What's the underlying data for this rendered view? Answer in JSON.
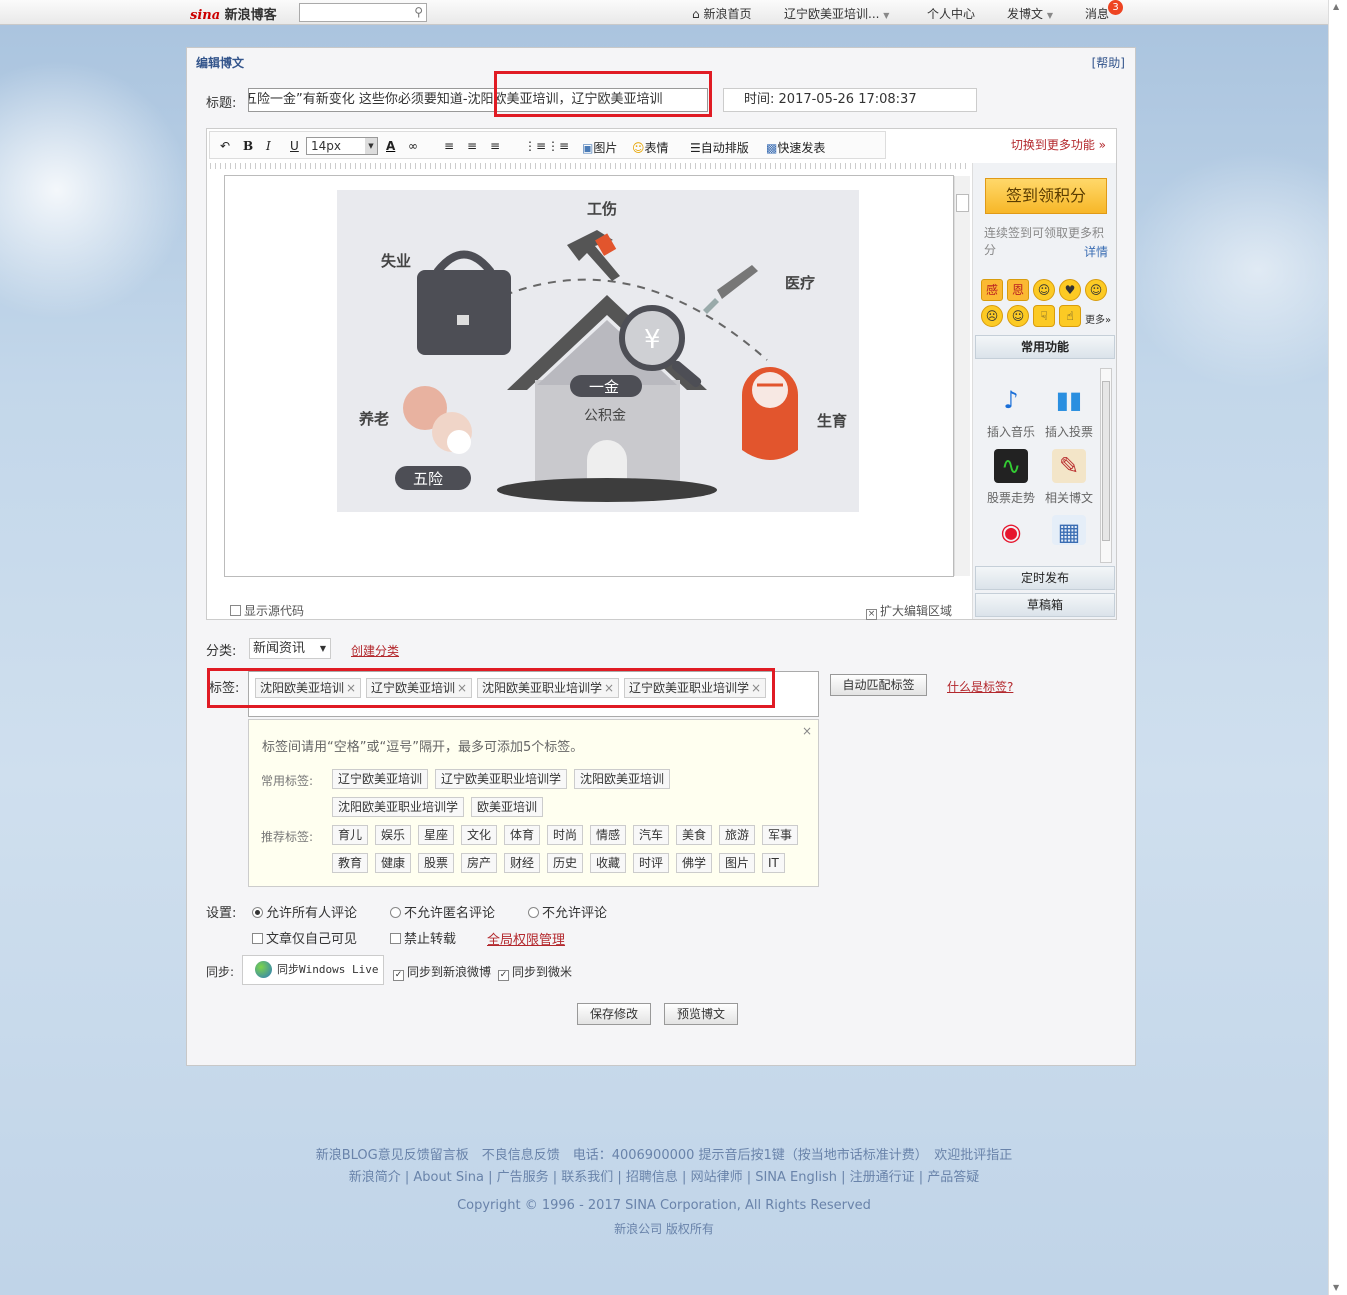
{
  "topbar": {
    "logo_sina": "sina",
    "logo_text": "新浪博客",
    "nav": [
      "新浪首页",
      "辽宁欧美亚培训...",
      "个人中心",
      "发博文",
      "消息"
    ],
    "badge": "3"
  },
  "panel": {
    "title": "编辑博文",
    "help": "[帮助]",
    "title_label": "标题:",
    "title_value": "五险一金”有新变化 这些你必须要知道-沈阳欧美亚培训，辽宁欧美亚培训",
    "time_label": "时间:",
    "time_value": "2017-05-26 17:08:37"
  },
  "toolbar": {
    "font_size": "14px",
    "image": "图片",
    "emotion": "表情",
    "autolayout": "自动排版",
    "quickpost": "快速发表",
    "more": "切换到更多功能"
  },
  "illustration": {
    "labels": [
      "工伤",
      "失业",
      "医疗",
      "养老",
      "生育",
      "一金",
      "公积金",
      "五险"
    ],
    "currency": "¥"
  },
  "editor": {
    "show_source": "显示源代码",
    "expand": "扩大编辑区域"
  },
  "side": {
    "sign_button": "签到领积分",
    "sign_text": "连续签到可领取更多积分",
    "detail": "详情",
    "emotions_more": "更多»",
    "emo_text": [
      "感",
      "恩"
    ],
    "common_header": "常用功能",
    "funcs": [
      "插入音乐",
      "插入投票",
      "股票走势",
      "相关博文"
    ],
    "schedule": "定时发布",
    "drafts": "草稿箱"
  },
  "category": {
    "label": "分类:",
    "value": "新闻资讯",
    "create": "创建分类"
  },
  "tags": {
    "label": "标签:",
    "items": [
      "沈阳欧美亚培训",
      "辽宁欧美亚培训",
      "沈阳欧美亚职业培训学",
      "辽宁欧美亚职业培训学"
    ],
    "auto_button": "自动匹配标签",
    "what": "什么是标签?",
    "tip": "标签间请用“空格”或“逗号”隔开，最多可添加5个标签。",
    "common_label": "常用标签:",
    "common": [
      "辽宁欧美亚培训",
      "辽宁欧美亚职业培训学",
      "沈阳欧美亚培训",
      "沈阳欧美亚职业培训学",
      "欧美亚培训"
    ],
    "recommend_label": "推荐标签:",
    "recommend": [
      "育儿",
      "娱乐",
      "星座",
      "文化",
      "体育",
      "时尚",
      "情感",
      "汽车",
      "美食",
      "旅游",
      "军事",
      "教育",
      "健康",
      "股票",
      "房产",
      "财经",
      "历史",
      "收藏",
      "时评",
      "佛学",
      "图片",
      "IT"
    ]
  },
  "settings": {
    "label": "设置:",
    "options": [
      "允许所有人评论",
      "不允许匿名评论",
      "不允许评论"
    ],
    "private": "文章仅自己可见",
    "no_forward": "禁止转载",
    "global": "全局权限管理"
  },
  "sync": {
    "label": "同步:",
    "windows_live": "同步Windows Live",
    "weibo": "同步到新浪微博",
    "weimi": "同步到微米"
  },
  "buttons": {
    "save": "保存修改",
    "preview": "预览博文"
  },
  "footer": {
    "line1": "新浪BLOG意见反馈留言板　不良信息反馈　电话：4006900000 提示音后按1键（按当地市话标准计费）　欢迎批评指正",
    "line2": "新浪简介 | About Sina | 广告服务 | 联系我们 | 招聘信息 | 网站律师 | SINA English | 注册通行证 | 产品答疑",
    "copyright": "Copyright © 1996 - 2017 SINA Corporation, All Rights Reserved",
    "rights": "新浪公司 版权所有"
  }
}
